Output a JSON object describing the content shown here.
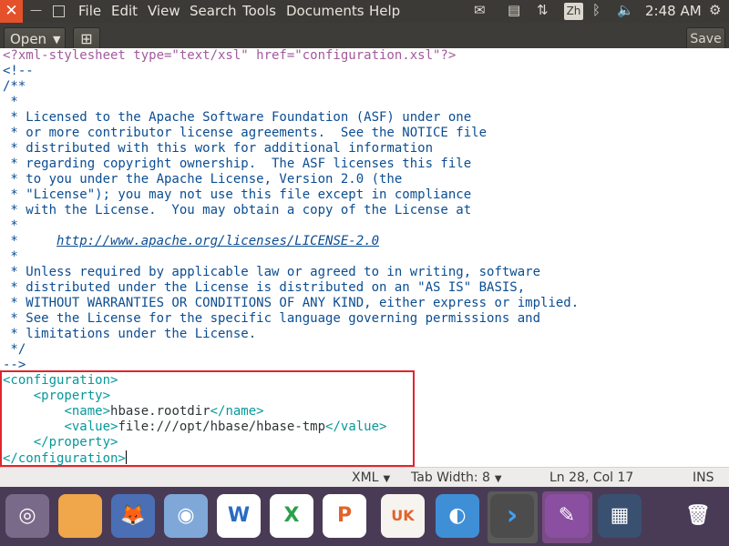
{
  "menubar": {
    "menus": [
      "File",
      "Edit",
      "View",
      "Search",
      "Tools",
      "Documents",
      "Help"
    ],
    "input_method": "Zh",
    "clock": "2:48 AM"
  },
  "toolbar": {
    "open_label": "Open",
    "save_label": "Save"
  },
  "editor": {
    "lines": [
      {
        "cls": "xmldecl",
        "text": "<?xml-stylesheet type=\"text/xsl\" href=\"configuration.xsl\"?>"
      },
      {
        "cls": "comment",
        "text": "<!--"
      },
      {
        "cls": "comment",
        "text": "/**"
      },
      {
        "cls": "comment",
        "text": " *"
      },
      {
        "cls": "comment",
        "text": " * Licensed to the Apache Software Foundation (ASF) under one"
      },
      {
        "cls": "comment",
        "text": " * or more contributor license agreements.  See the NOTICE file"
      },
      {
        "cls": "comment",
        "text": " * distributed with this work for additional information"
      },
      {
        "cls": "comment",
        "text": " * regarding copyright ownership.  The ASF licenses this file"
      },
      {
        "cls": "comment",
        "text": " * to you under the Apache License, Version 2.0 (the"
      },
      {
        "cls": "comment",
        "text": " * \"License\"); you may not use this file except in compliance"
      },
      {
        "cls": "comment",
        "text": " * with the License.  You may obtain a copy of the License at"
      },
      {
        "cls": "comment",
        "text": " *"
      },
      {
        "cls": "comment",
        "text": " *     ",
        "url": "http://www.apache.org/licenses/LICENSE-2.0"
      },
      {
        "cls": "comment",
        "text": " *"
      },
      {
        "cls": "comment",
        "text": " * Unless required by applicable law or agreed to in writing, software"
      },
      {
        "cls": "comment",
        "text": " * distributed under the License is distributed on an \"AS IS\" BASIS,"
      },
      {
        "cls": "comment",
        "text": " * WITHOUT WARRANTIES OR CONDITIONS OF ANY KIND, either express or implied."
      },
      {
        "cls": "comment",
        "text": " * See the License for the specific language governing permissions and"
      },
      {
        "cls": "comment",
        "text": " * limitations under the License."
      },
      {
        "cls": "comment",
        "text": " */"
      },
      {
        "cls": "comment",
        "text": "-->"
      },
      {
        "cls": "tag",
        "text": "<configuration>"
      },
      {
        "cls": "tag",
        "text": "    <property>"
      },
      {
        "cls": "mixed",
        "indent": "        ",
        "open": "<name>",
        "value": "hbase.rootdir",
        "close": "</name>"
      },
      {
        "cls": "mixed",
        "indent": "        ",
        "open": "<value>",
        "value": "file:///opt/hbase/hbase-tmp",
        "close": "</value>"
      },
      {
        "cls": "tag",
        "text": "    </property>"
      },
      {
        "cls": "tag",
        "text": "</configuration>",
        "cursor": true
      }
    ]
  },
  "statusbar": {
    "language": "XML",
    "tab_width": "Tab Width: 8",
    "position": "Ln 28, Col 17",
    "mode": "INS"
  },
  "dock": {
    "items": [
      {
        "icon": "ubuntu-icon",
        "bg": "#7a6a8a",
        "glyph": "◎"
      },
      {
        "icon": "files-icon",
        "bg": "#f0a64a",
        "glyph": ""
      },
      {
        "icon": "firefox-icon",
        "bg": "#4a6fb5",
        "glyph": "🦊"
      },
      {
        "icon": "chromium-icon",
        "bg": "#7fa8d8",
        "glyph": "◉"
      },
      {
        "icon": "writer-icon",
        "bg": "#ffffff",
        "glyph": "W"
      },
      {
        "icon": "calc-icon",
        "bg": "#ffffff",
        "glyph": "X"
      },
      {
        "icon": "impress-icon",
        "bg": "#ffffff",
        "glyph": "P"
      },
      {
        "icon": "software-center-icon",
        "bg": "#f7f3ee",
        "glyph": "UK"
      },
      {
        "icon": "remote-desktop-icon",
        "bg": "#3f8fd6",
        "glyph": "◐"
      },
      {
        "icon": "terminal-icon",
        "bg": "#4c4c4c",
        "glyph": "›"
      },
      {
        "icon": "text-editor-icon",
        "bg": "#8a4fa0",
        "glyph": "✎"
      },
      {
        "icon": "workspace-switcher-icon",
        "bg": "#3a5070",
        "glyph": "▦"
      },
      {
        "icon": "trash-icon",
        "bg": "#493b56",
        "glyph": "🗑"
      }
    ]
  }
}
